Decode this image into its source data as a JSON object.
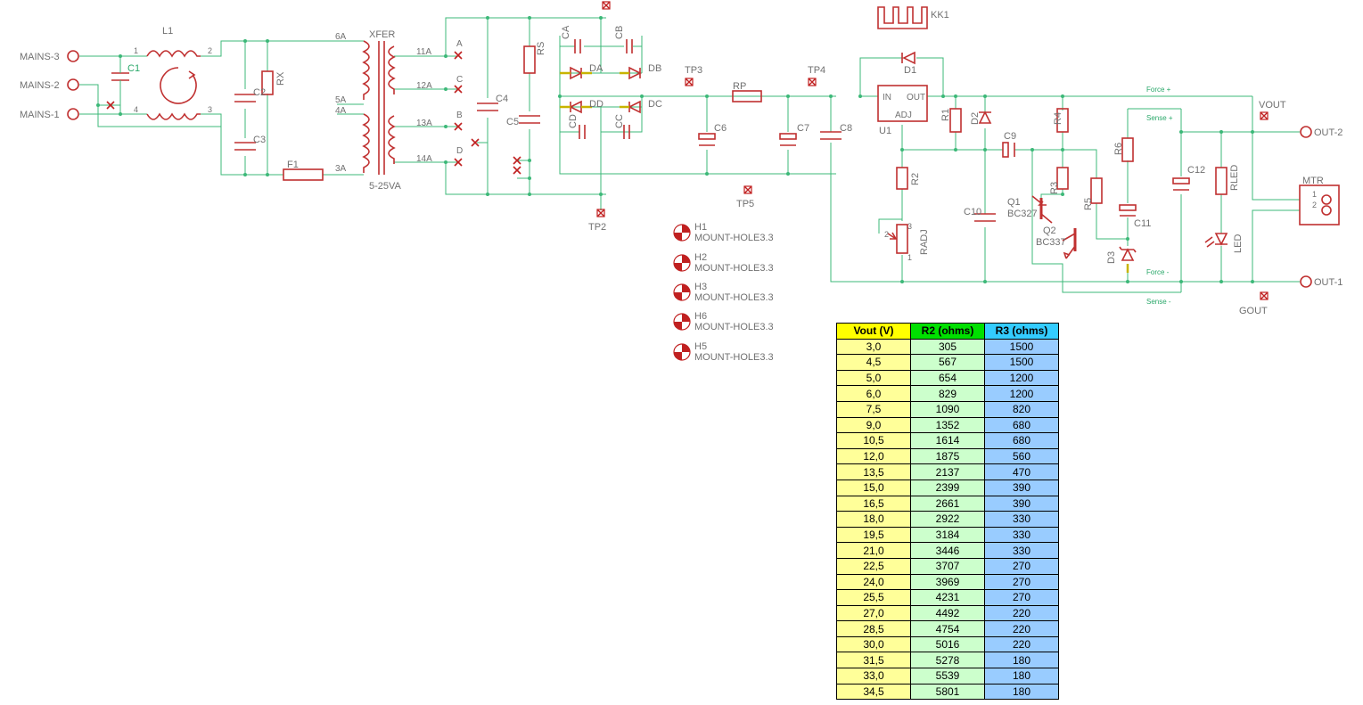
{
  "schematic": {
    "connectors": {
      "mains3": "MAINS-3",
      "mains2": "MAINS-2",
      "mains1": "MAINS-1",
      "out2": "OUT-2",
      "out1": "OUT-1",
      "vout": "VOUT",
      "gout": "GOUT",
      "mtr": "MTR"
    },
    "components": {
      "l1": "L1",
      "c1": "C1",
      "c2": "C2",
      "c3": "C3",
      "rx": "RX",
      "f1": "F1",
      "xfer": "XFER",
      "xfer_rating": "5-25VA",
      "c4": "C4",
      "c5": "C5",
      "rs": "RS",
      "ca": "CA",
      "cb": "CB",
      "cc": "CC",
      "cd": "CD",
      "da": "DA",
      "db": "DB",
      "dc": "DC",
      "dd": "DD",
      "c6": "C6",
      "rp": "RP",
      "c7": "C7",
      "c8": "C8",
      "d1": "D1",
      "kk1": "KK1",
      "u1": "U1",
      "u1_in": "IN",
      "u1_out": "OUT",
      "u1_adj": "ADJ",
      "r1": "R1",
      "d2": "D2",
      "c9": "C9",
      "r4": "R4",
      "r6": "R6",
      "r2": "R2",
      "radj": "RADJ",
      "c10": "C10",
      "r3": "R3",
      "r5": "R5",
      "q1": "Q1",
      "q1_type": "BC327",
      "q2": "Q2",
      "q2_type": "BC337",
      "c11": "C11",
      "d3": "D3",
      "c12": "C12",
      "rled": "RLED",
      "led": "LED"
    },
    "testpoints": {
      "tp2": "TP2",
      "tp3": "TP3",
      "tp4": "TP4",
      "tp5": "TP5"
    },
    "pins": {
      "l1_1": "1",
      "l1_2": "2",
      "l1_3": "3",
      "l1_4": "4",
      "x6a": "6A",
      "x5a": "5A",
      "x4a": "4A",
      "x3a": "3A",
      "x11a": "11A",
      "x12a": "12A",
      "x13a": "13A",
      "x14a": "14A",
      "a": "A",
      "c": "C",
      "b": "B",
      "d": "D",
      "mtr1": "1",
      "mtr2": "2",
      "radj1": "1",
      "radj2": "2",
      "radj3": "3"
    },
    "nets": {
      "force_plus": "Force +",
      "sense_plus": "Sense +",
      "force_minus": "Force -",
      "sense_minus": "Sense -"
    },
    "mount_holes": [
      {
        "ref": "H1",
        "value": "MOUNT-HOLE3.3"
      },
      {
        "ref": "H2",
        "value": "MOUNT-HOLE3.3"
      },
      {
        "ref": "H3",
        "value": "MOUNT-HOLE3.3"
      },
      {
        "ref": "H6",
        "value": "MOUNT-HOLE3.3"
      },
      {
        "ref": "H5",
        "value": "MOUNT-HOLE3.3"
      }
    ]
  },
  "table": {
    "headers": [
      "Vout (V)",
      "R2 (ohms)",
      "R3 (ohms)"
    ],
    "rows": [
      [
        "3,0",
        "305",
        "1500"
      ],
      [
        "4,5",
        "567",
        "1500"
      ],
      [
        "5,0",
        "654",
        "1200"
      ],
      [
        "6,0",
        "829",
        "1200"
      ],
      [
        "7,5",
        "1090",
        "820"
      ],
      [
        "9,0",
        "1352",
        "680"
      ],
      [
        "10,5",
        "1614",
        "680"
      ],
      [
        "12,0",
        "1875",
        "560"
      ],
      [
        "13,5",
        "2137",
        "470"
      ],
      [
        "15,0",
        "2399",
        "390"
      ],
      [
        "16,5",
        "2661",
        "390"
      ],
      [
        "18,0",
        "2922",
        "330"
      ],
      [
        "19,5",
        "3184",
        "330"
      ],
      [
        "21,0",
        "3446",
        "330"
      ],
      [
        "22,5",
        "3707",
        "270"
      ],
      [
        "24,0",
        "3969",
        "270"
      ],
      [
        "25,5",
        "4231",
        "270"
      ],
      [
        "27,0",
        "4492",
        "220"
      ],
      [
        "28,5",
        "4754",
        "220"
      ],
      [
        "30,0",
        "5016",
        "220"
      ],
      [
        "31,5",
        "5278",
        "180"
      ],
      [
        "33,0",
        "5539",
        "180"
      ],
      [
        "34,5",
        "5801",
        "180"
      ]
    ]
  },
  "colors": {
    "component": "#c03030",
    "wire": "#3cb878",
    "label": "#707070",
    "pad": "#c02020",
    "bridge_lead": "#c8b400"
  }
}
